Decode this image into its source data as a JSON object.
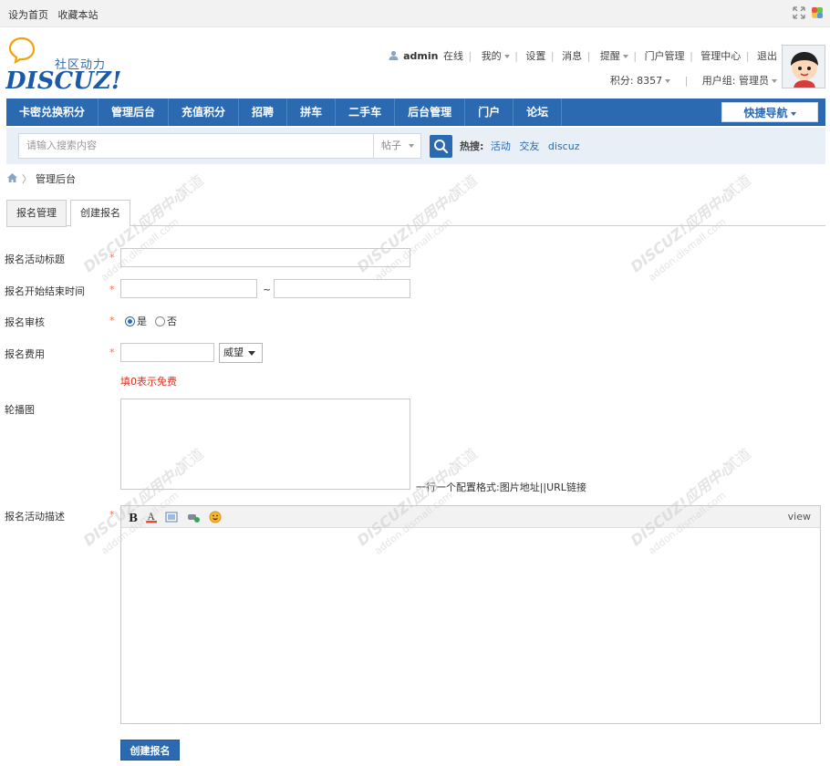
{
  "topbar": {
    "links": [
      "设为首页",
      "收藏本站"
    ]
  },
  "header": {
    "logo_sub": "社区动力",
    "logo_main": "DISCUZ!",
    "user": {
      "name": "admin",
      "status": "在线",
      "menu": [
        "我的",
        "设置",
        "消息",
        "提醒",
        "门户管理",
        "管理中心",
        "退出"
      ],
      "points": "积分: 8357",
      "group": "用户组: 管理员"
    }
  },
  "nav": {
    "items": [
      "卡密兑换积分",
      "管理后台",
      "充值积分",
      "招聘",
      "拼车",
      "二手车",
      "后台管理",
      "门户",
      "论坛"
    ],
    "quick_nav": "快捷导航"
  },
  "search": {
    "placeholder": "请输入搜索内容",
    "scope": "帖子",
    "hot_label": "热搜:",
    "hot": [
      "活动",
      "交友",
      "discuz"
    ]
  },
  "breadcrumb": {
    "current": "管理后台"
  },
  "tabs": [
    "报名管理",
    "创建报名"
  ],
  "form": {
    "title_label": "报名活动标题",
    "time_label": "报名开始结束时间",
    "time_sep": "~",
    "review_label": "报名审核",
    "review_yes": "是",
    "review_no": "否",
    "fee_label": "报名费用",
    "fee_unit": "威望",
    "fee_hint": "填0表示免费",
    "carousel_label": "轮播图",
    "carousel_note": "一行一个配置格式:图片地址||URL链接",
    "desc_label": "报名活动描述",
    "editor_view": "view",
    "submit": "创建报名"
  },
  "watermark": {
    "text1": "DISCUZ!应用中心",
    "text2": "addon.dismall.com",
    "text3": "贰道"
  },
  "colors": {
    "brand_blue": "#2b6ab0",
    "required_star": "#f26c4f",
    "hint_red": "#e0301e"
  }
}
